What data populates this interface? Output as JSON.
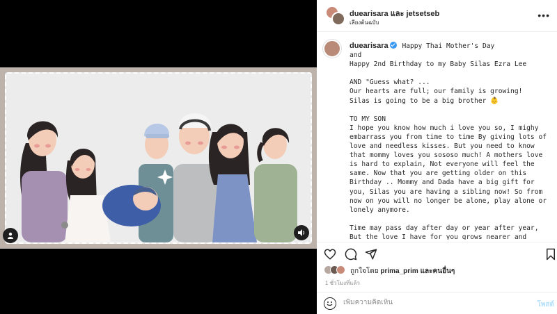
{
  "header": {
    "title": "duearisara และ jetsetseb",
    "subtitle": "เลียงต้นฉบับ"
  },
  "caption": {
    "username": "duearisara",
    "text": "Happy Thai Mother's Day\nand\nHappy 2nd Birthday to my Baby Silas Ezra Lee\n\nAND \"Guess what? ...\nOur hearts are full; our family is growing!\nSilas is going to be a big brother 👶\n\nTO MY SON\nI hope you know how much i love you so, I mighy embarrass you from time to time By giving lots of love and needless kisses. But you need to know that mommy loves you sososo much! A mothers love is hard to explain, Not everyone will feel the same. Now that you are getting older on this Birthday .. Mommy and Dada have a big gift for you, Silas you are having a sibling now! So from now on you will no longer be alone, play alone or lonely anymore.\n\nTime may pass day after day or year after year, But the love I have for you grows nearer and dearer to"
  },
  "likes": {
    "prefix": "ถูกใจโดย",
    "user": "prima_prim",
    "suffix": "และคนอื่นๆ"
  },
  "time": "1 ชั่วโมงที่แล้ว",
  "comment": {
    "placeholder": "เพิ่มความคิดเห็น",
    "post_label": "โพสต์"
  },
  "icons": {
    "more": "more-icon",
    "like": "heart-icon",
    "comment": "comment-icon",
    "share": "share-icon",
    "save": "bookmark-icon",
    "emoji": "emoji-icon",
    "user": "user-tag-icon",
    "sound": "speaker-icon"
  },
  "colors": {
    "frame": "#bdb3aa",
    "card": "#ececec",
    "verified": "#3897f0",
    "post_disabled": "#b2dffc"
  }
}
